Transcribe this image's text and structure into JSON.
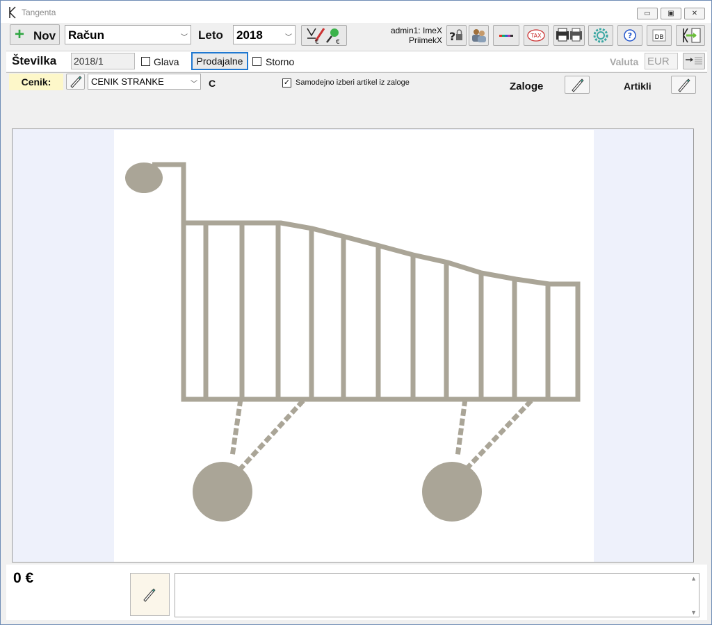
{
  "window": {
    "title": "Tangenta"
  },
  "toolbar": {
    "new_label": "Nov",
    "doc_type": "Račun",
    "year_label": "Leto",
    "year": "2018",
    "user_line1": "admin1: ImeX",
    "user_line2": "PriimekX",
    "tax_label": "TAX",
    "db_label": "DB"
  },
  "header": {
    "number_label": "Številka",
    "number_value": "2018/1",
    "glava_label": "Glava",
    "glava_checked": false,
    "prodajalne_label": "Prodajalne",
    "storno_label": "Storno",
    "storno_checked": false,
    "valuta_label": "Valuta",
    "valuta_value": "EUR"
  },
  "pricing": {
    "cenik_label": "Cenik:",
    "cenik_value": "CENIK STRANKE",
    "cenik_code": "C",
    "auto_label": "Samodejno izberi artikel iz zaloge",
    "auto_checked": true,
    "zaloge_label": "Zaloge",
    "artikli_label": "Artikli"
  },
  "footer": {
    "total": "0 €"
  },
  "colors": {
    "accent_blue": "#1f78d1",
    "cart_gray": "#aaa597",
    "label_yellow": "#fdf7c9",
    "plus_green": "#2fa642"
  }
}
